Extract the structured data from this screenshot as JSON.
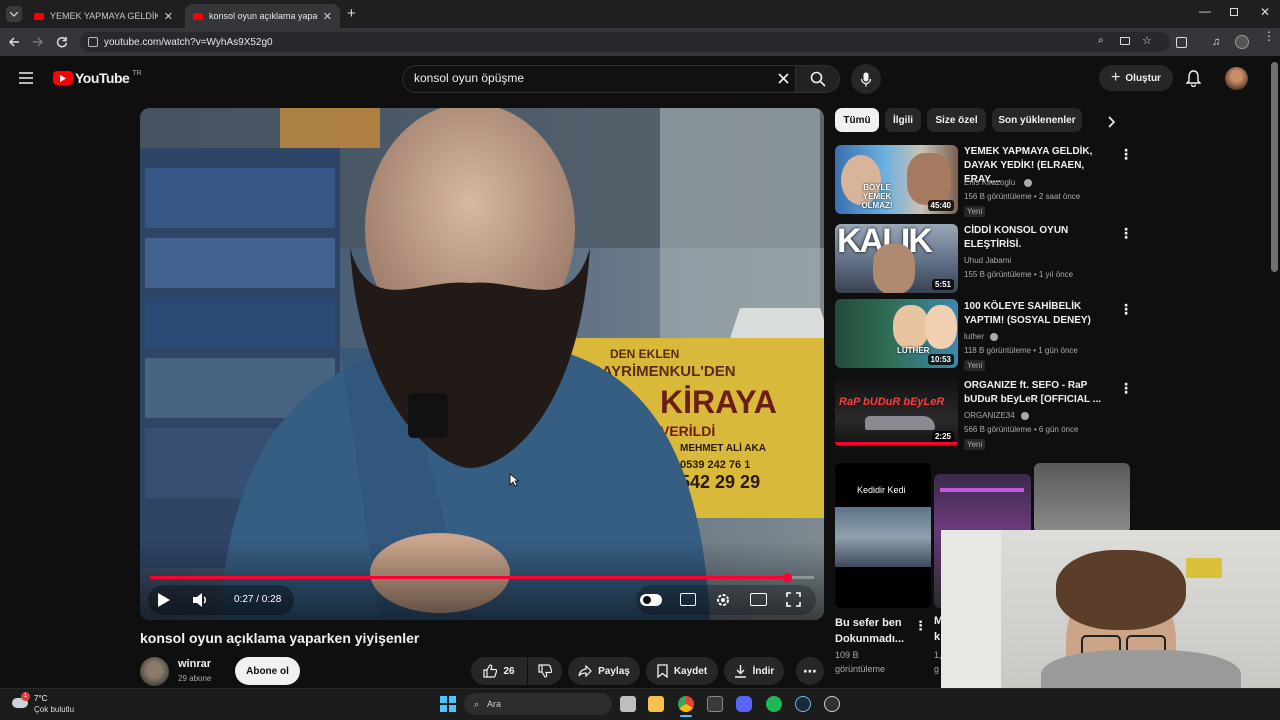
{
  "browser": {
    "tabs": [
      {
        "title": "YEMEK YAPMAYA GELDİK, DAYA"
      },
      {
        "title": "konsol oyun açıklama yaparken"
      }
    ],
    "url": "youtube.com/watch?v=WyhAs9X52g0"
  },
  "header": {
    "logo_text": "YouTube",
    "region": "TR",
    "search_query": "konsol oyun öpüşme",
    "create_label": "Oluştur"
  },
  "player": {
    "time": "0:27 / 0:28",
    "progress": 0.96,
    "signs": {
      "line1": "GAYRİMENKUL'DEN",
      "line2": "KİRAYA",
      "line3": "VERİLDİ",
      "name": "MEHMET ALİ AKA",
      "phone1": "0539 242 76 1",
      "phone2": "542 29 29",
      "top": "DEN EKLEN"
    }
  },
  "video": {
    "title": "konsol oyun açıklama yaparken yiyişenler",
    "channel": "winrar",
    "subscribers": "29 abone",
    "subscribe_label": "Abone ol",
    "likes": "26",
    "share_label": "Paylaş",
    "save_label": "Kaydet",
    "download_label": "İndir"
  },
  "chips": [
    "Tümü",
    "İlgili",
    "Size özel",
    "Son yüklenenler"
  ],
  "recommendations": [
    {
      "title": "YEMEK YAPMAYA GELDİK, DAYAK YEDİK! (ELRAEN, ERAY,...",
      "channel": "Enis Kirazoglu",
      "meta": "156 B görüntüleme • 2 saat önce",
      "badge": "Yeni",
      "duration": "45:40",
      "thumb_text": "BÖYLE YEMEK OLMAZ!"
    },
    {
      "title": "CİDDİ KONSOL OYUN ELEŞTİRİSİ.",
      "channel": "Uhud Jabami",
      "meta": "155 B görüntüleme • 1 yıl önce",
      "badge": "",
      "duration": "5:51",
      "thumb_text": "KALIK"
    },
    {
      "title": "100 KÖLEYE SAHİBELİK YAPTIM! (SOSYAL DENEY)",
      "channel": "luther",
      "meta": "118 B görüntüleme • 1 gün önce",
      "badge": "Yeni",
      "duration": "10:53",
      "thumb_text": "LUTHER"
    },
    {
      "title": "ORGANIZE ft. SEFO - RaP bUDuR bEyLeR [OFFICIAL ...",
      "channel": "ORGANIZE34",
      "meta": "566 B görüntüleme • 6 gün önce",
      "badge": "Yeni",
      "duration": "2:25",
      "thumb_text": "RaP bUDuR bEyLeR"
    }
  ],
  "shorts": [
    {
      "title": "Bu sefer ben Dokunmadı...",
      "views": "109 B",
      "views_label": "görüntüleme",
      "thumb_text": "Kedidir Kedi"
    },
    {
      "title": "M",
      "line2": "k",
      "views": "1,",
      "views_label": "g"
    }
  ],
  "taskbar": {
    "weather_temp": "7°C",
    "weather_desc": "Çok bulutlu",
    "search_label": "Ara",
    "notification_count": "1"
  },
  "colors": {
    "accent": "#ff0000",
    "background": "#0f0f0f",
    "chip": "#272727"
  }
}
